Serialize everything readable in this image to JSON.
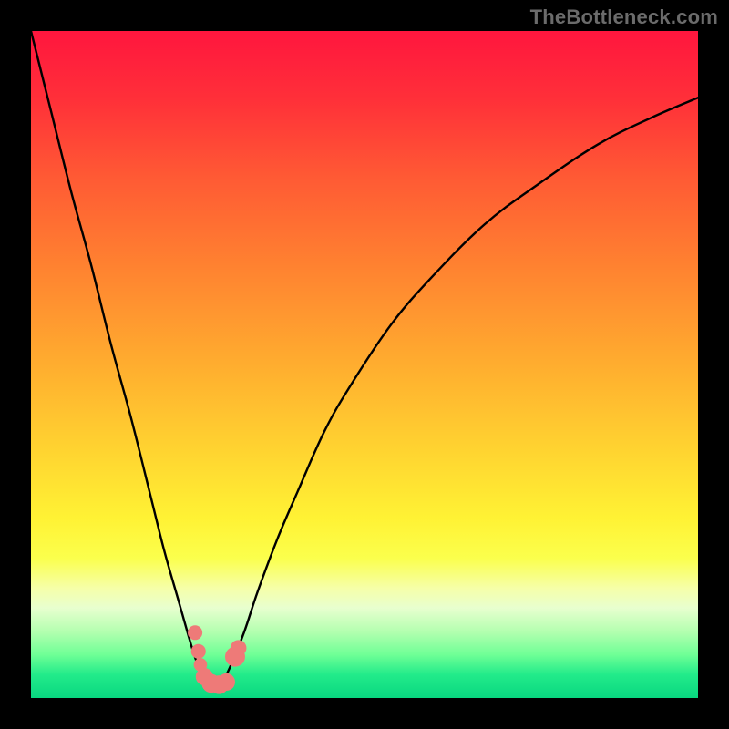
{
  "watermark": "TheBottleneck.com",
  "chart_data": {
    "type": "line",
    "title": "",
    "xlabel": "",
    "ylabel": "",
    "xlim": [
      0,
      100
    ],
    "ylim": [
      0,
      100
    ],
    "optimal_x": 27,
    "series": [
      {
        "name": "bottleneck-curve",
        "x": [
          0,
          3,
          6,
          9,
          12,
          15,
          18,
          20,
          22,
          24,
          25,
          26,
          27,
          28,
          29,
          30,
          32,
          34,
          37,
          40,
          44,
          48,
          54,
          60,
          68,
          76,
          85,
          93,
          100
        ],
        "y": [
          100,
          88,
          76,
          65,
          53,
          42,
          30,
          22,
          15,
          8,
          5,
          3,
          2,
          2,
          3,
          5,
          10,
          16,
          24,
          31,
          40,
          47,
          56,
          63,
          71,
          77,
          83,
          87,
          90
        ]
      }
    ],
    "markers": [
      {
        "name": "marker-a",
        "x": 24.6,
        "y": 9.8,
        "r": 1.1,
        "color": "#ee7a78"
      },
      {
        "name": "marker-b",
        "x": 25.1,
        "y": 7.0,
        "r": 1.1,
        "color": "#ee7a78"
      },
      {
        "name": "marker-c",
        "x": 25.4,
        "y": 5.0,
        "r": 1.0,
        "color": "#ee7a78"
      },
      {
        "name": "marker-d",
        "x": 26.0,
        "y": 3.2,
        "r": 1.3,
        "color": "#ee7a78"
      },
      {
        "name": "marker-e",
        "x": 27.0,
        "y": 2.2,
        "r": 1.4,
        "color": "#ee7a78"
      },
      {
        "name": "marker-f",
        "x": 28.2,
        "y": 2.0,
        "r": 1.4,
        "color": "#ee7a78"
      },
      {
        "name": "marker-g",
        "x": 29.3,
        "y": 2.4,
        "r": 1.3,
        "color": "#ee7a78"
      },
      {
        "name": "marker-h",
        "x": 30.6,
        "y": 6.2,
        "r": 1.5,
        "color": "#ee7a78"
      },
      {
        "name": "marker-i",
        "x": 31.1,
        "y": 7.5,
        "r": 1.2,
        "color": "#ee7a78"
      }
    ],
    "gradient_stops": [
      {
        "offset": 0.0,
        "color": "#ff163e"
      },
      {
        "offset": 0.1,
        "color": "#ff2f39"
      },
      {
        "offset": 0.22,
        "color": "#ff5a34"
      },
      {
        "offset": 0.36,
        "color": "#ff8430"
      },
      {
        "offset": 0.5,
        "color": "#ffad2f"
      },
      {
        "offset": 0.62,
        "color": "#ffd130"
      },
      {
        "offset": 0.73,
        "color": "#fff234"
      },
      {
        "offset": 0.79,
        "color": "#fbff4c"
      },
      {
        "offset": 0.835,
        "color": "#f6ffa8"
      },
      {
        "offset": 0.865,
        "color": "#e8ffcf"
      },
      {
        "offset": 0.9,
        "color": "#b4ffb0"
      },
      {
        "offset": 0.935,
        "color": "#6fff96"
      },
      {
        "offset": 0.965,
        "color": "#22eb8a"
      },
      {
        "offset": 1.0,
        "color": "#09d780"
      }
    ]
  }
}
